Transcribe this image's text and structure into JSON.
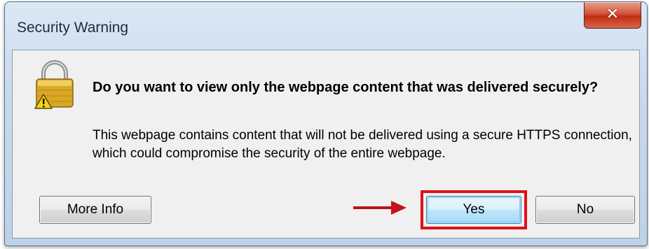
{
  "dialog": {
    "title": "Security Warning",
    "close_icon": "close-icon",
    "warning_icon": "lock-warning-icon",
    "heading": "Do you want to view only the webpage content that was delivered securely?",
    "message": "This webpage contains content that will not be delivered using a secure HTTPS connection, which could compromise the security of the entire webpage.",
    "buttons": {
      "more_info": "More Info",
      "yes": "Yes",
      "no": "No"
    },
    "annotation": {
      "arrow_icon": "arrow-right-icon",
      "highlight_color": "#e0101a"
    }
  }
}
